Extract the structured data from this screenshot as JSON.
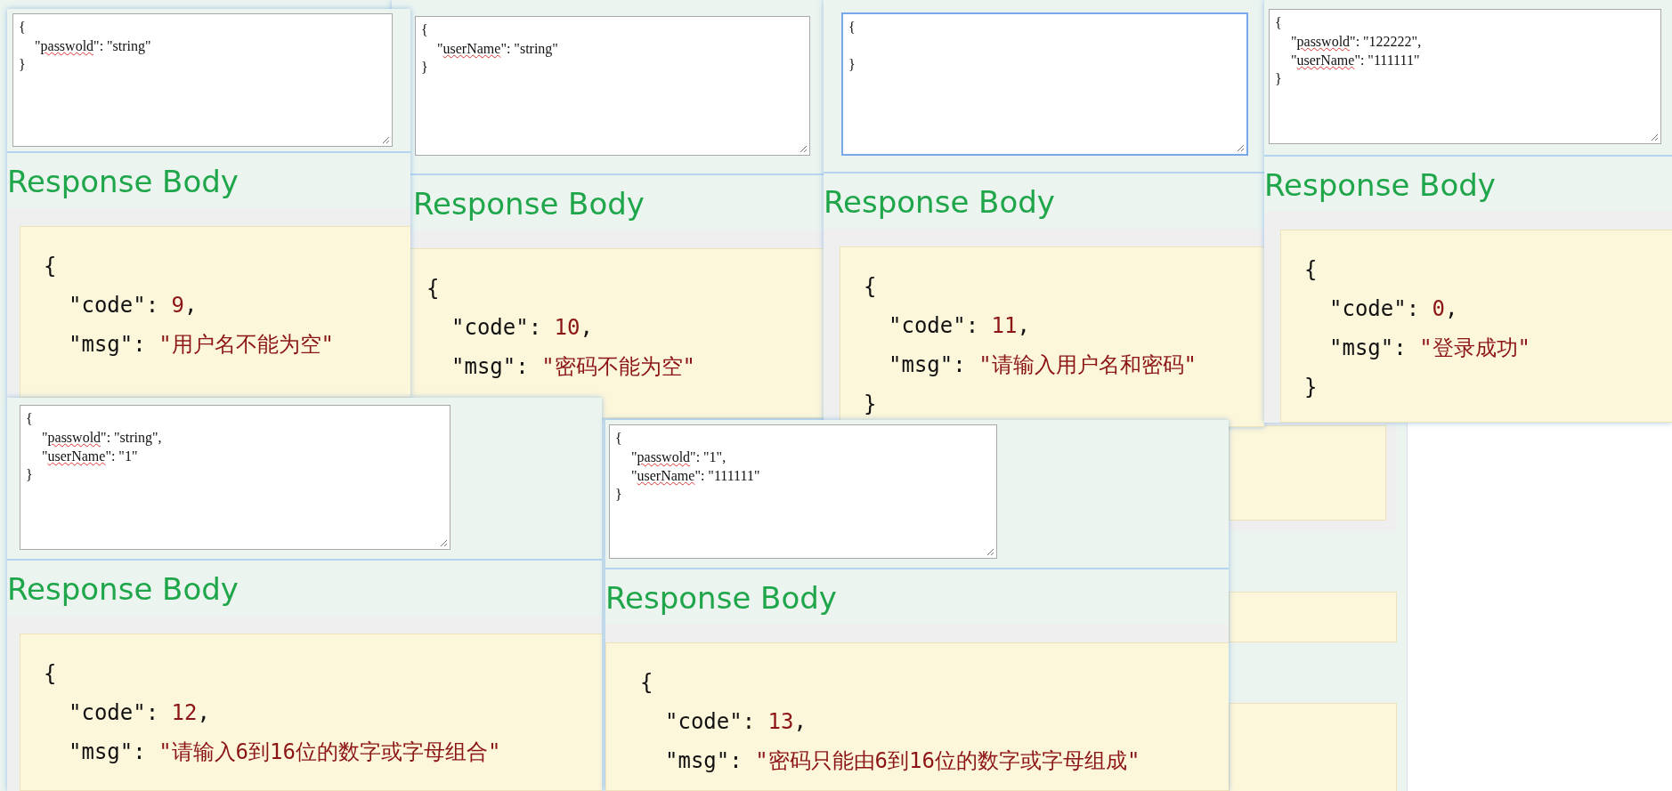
{
  "panels": [
    {
      "request_body": {
        "focused": false,
        "lines": [
          {
            "kind": "brace",
            "text": "{"
          },
          {
            "kind": "pair",
            "pre": "\"",
            "key": "passwold",
            "post": "\": \"string\""
          },
          {
            "kind": "brace",
            "text": "}"
          }
        ]
      },
      "heading": "Response Body",
      "response_lines": [
        {
          "kind": "brace",
          "text": "{"
        },
        {
          "kind": "pair",
          "key": "\"code\": ",
          "value": "9",
          "suffix": ","
        },
        {
          "kind": "pair",
          "key": "\"msg\": ",
          "value": "\"用户名不能为空\""
        }
      ]
    },
    {
      "request_body": {
        "focused": false,
        "lines": [
          {
            "kind": "brace",
            "text": "{"
          },
          {
            "kind": "pair",
            "pre": "\"",
            "key": "userName",
            "post": "\": \"string\""
          },
          {
            "kind": "brace",
            "text": "}"
          }
        ]
      },
      "heading": "Response Body",
      "response_lines": [
        {
          "kind": "brace",
          "text": "{"
        },
        {
          "kind": "pair",
          "key": "\"code\": ",
          "value": "10",
          "suffix": ","
        },
        {
          "kind": "pair",
          "key": "\"msg\": ",
          "value": "\"密码不能为空\""
        }
      ]
    },
    {
      "request_body": {
        "focused": true,
        "lines": [
          {
            "kind": "brace",
            "text": "{"
          },
          {
            "kind": "blank"
          },
          {
            "kind": "brace",
            "text": "}"
          }
        ]
      },
      "heading": "Response Body",
      "response_lines": [
        {
          "kind": "brace",
          "text": "{"
        },
        {
          "kind": "pair",
          "key": "\"code\": ",
          "value": "11",
          "suffix": ","
        },
        {
          "kind": "pair",
          "key": "\"msg\": ",
          "value": "\"请输入用户名和密码\""
        },
        {
          "kind": "brace",
          "text": "}"
        }
      ]
    },
    {
      "request_body": {
        "focused": false,
        "lines": [
          {
            "kind": "brace",
            "text": "{"
          },
          {
            "kind": "pair",
            "pre": "\"",
            "key": "passwold",
            "post": "\": \"122222\","
          },
          {
            "kind": "pair",
            "pre": "\"",
            "key": "userName",
            "post": "\": \"111111\""
          },
          {
            "kind": "brace",
            "text": "}"
          }
        ]
      },
      "heading": "Response Body",
      "response_lines": [
        {
          "kind": "brace",
          "text": "{"
        },
        {
          "kind": "pair",
          "key": "\"code\": ",
          "value": "0",
          "suffix": ","
        },
        {
          "kind": "pair",
          "key": "\"msg\": ",
          "value": "\"登录成功\""
        },
        {
          "kind": "brace",
          "text": "}"
        }
      ]
    },
    {
      "request_body": {
        "focused": false,
        "lines": [
          {
            "kind": "brace",
            "text": "{"
          },
          {
            "kind": "pair",
            "pre": "\"",
            "key": "passwold",
            "post": "\": \"string\","
          },
          {
            "kind": "pair",
            "pre": "\"",
            "key": "userName",
            "post": "\": \"1\""
          },
          {
            "kind": "brace",
            "text": "}"
          }
        ]
      },
      "heading": "Response Body",
      "response_lines": [
        {
          "kind": "brace",
          "text": "{"
        },
        {
          "kind": "pair",
          "key": "\"code\": ",
          "value": "12",
          "suffix": ","
        },
        {
          "kind": "pair",
          "key": "\"msg\": ",
          "value": "\"请输入6到16位的数字或字母组合\""
        }
      ]
    },
    {
      "request_body": {
        "focused": false,
        "lines": [
          {
            "kind": "brace",
            "text": "{"
          },
          {
            "kind": "pair",
            "pre": "\"",
            "key": "passwold",
            "post": "\": \"1\","
          },
          {
            "kind": "pair",
            "pre": "\"",
            "key": "userName",
            "post": "\": \"111111\""
          },
          {
            "kind": "brace",
            "text": "}"
          }
        ]
      },
      "heading": "Response Body",
      "response_lines": [
        {
          "kind": "brace",
          "text": "{"
        },
        {
          "kind": "pair",
          "key": "\"code\": ",
          "value": "13",
          "suffix": ","
        },
        {
          "kind": "pair",
          "key": "\"msg\": ",
          "value": "\"密码只能由6到16位的数字或字母组成\""
        }
      ]
    }
  ]
}
